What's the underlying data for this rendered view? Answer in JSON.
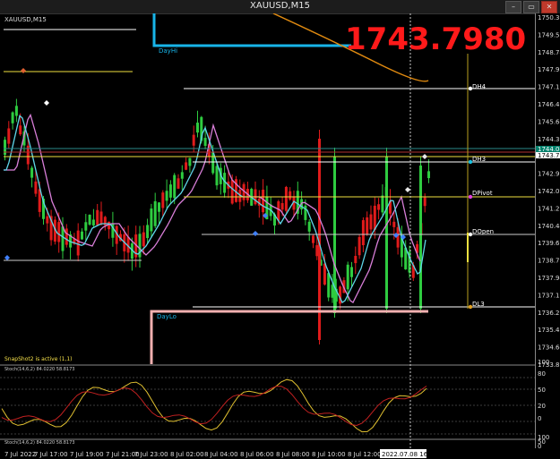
{
  "window": {
    "title": "XAUUSD,M15",
    "buttons": [
      "–",
      "▭",
      "✕"
    ]
  },
  "symbol_label": "XAUUSD,M15",
  "big_price": "1743.7980",
  "snapshot_text": "SnapShot2 is active (1,1)",
  "stoch_label": "Stoch(14,6,2) 84.0220 58.8173",
  "stoch2_label": "Stoch(14,6,2) 84.0220 58.8173",
  "price_axis": {
    "ticks": [
      "1750.399",
      "1749.519",
      "1748.749",
      "1747.974",
      "1747.199",
      "1746.424",
      "1745.649",
      "1744.399",
      "1743.796",
      "1742.924",
      "1742.099",
      "1741.274",
      "1740.449",
      "1739.624",
      "1738.799",
      "1737.949",
      "1737.124",
      "1736.299",
      "1735.474",
      "1734.649",
      "1733.824"
    ],
    "current_price": "1743.798",
    "bid_label": "1744.042"
  },
  "stoch_axis": {
    "ticks": [
      "100",
      "80",
      "50",
      "20",
      "0"
    ]
  },
  "stoch2_axis": {
    "ticks": [
      "100",
      "50",
      "0"
    ]
  },
  "time_axis": {
    "ticks": [
      "7 Jul 2022",
      "7 Jul 17:00",
      "7 Jul 19:00",
      "7 Jul 21:00",
      "7 Jul 23:00",
      "8 Jul 02:00",
      "8 Jul 04:00",
      "8 Jul 06:00",
      "8 Jul 08:00",
      "8 Jul 10:00",
      "8 Jul 12:00",
      "8 Jul 14:"
    ],
    "cursor_label": "2022.07.08 16:15"
  },
  "levels": {
    "dh4": "DH4",
    "dh3": "DH3",
    "dpivot": "DPivot",
    "dopen": "DOpen",
    "dl3": "DL3",
    "dayhi": "DayHi",
    "daylo": "DayLo"
  },
  "colors": {
    "up": "#2ecc40",
    "down": "#e01b1b",
    "ma_fast": "#5fd6e8",
    "ma_slow": "#d97fd9",
    "level_white": "#ffffff",
    "level_yellow": "#f0e040",
    "dayhi": "#18b4e8",
    "daylo": "#f2b0b0",
    "big_price": "#ff1a1a",
    "orange_line": "#e08a10"
  }
}
